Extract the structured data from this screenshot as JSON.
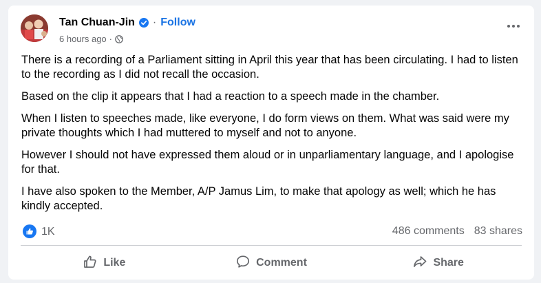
{
  "post": {
    "author": "Tan Chuan-Jin",
    "separator": "·",
    "follow_label": "Follow",
    "time": "6 hours ago",
    "meta_separator": "·",
    "paragraphs": [
      "There is a recording of a Parliament sitting in April this year that has been circulating. I had to listen to the recording as I did not recall the occasion.",
      "Based on the clip it appears that I had a reaction to a speech made in the chamber.",
      "When I listen to speeches made, like everyone, I do form views on them. What was said were my private thoughts which I had muttered to myself and not to anyone.",
      "However I should not have expressed them aloud or in unparliamentary language, and I apologise for that.",
      "I have also spoken to the Member, A/P Jamus Lim, to make that apology as well; which he has kindly accepted."
    ],
    "reactions_count": "1K",
    "comments": "486 comments",
    "shares": "83 shares"
  },
  "actions": {
    "like": "Like",
    "comment": "Comment",
    "share": "Share"
  },
  "icons": {
    "verified": "verified-badge-icon",
    "privacy": "globe-icon",
    "more": "more-options-icon",
    "reaction": "like-reaction-icon"
  },
  "colors": {
    "accent": "#1b74e4",
    "like_badge": "#1877f2",
    "secondary_text": "#65676b"
  }
}
